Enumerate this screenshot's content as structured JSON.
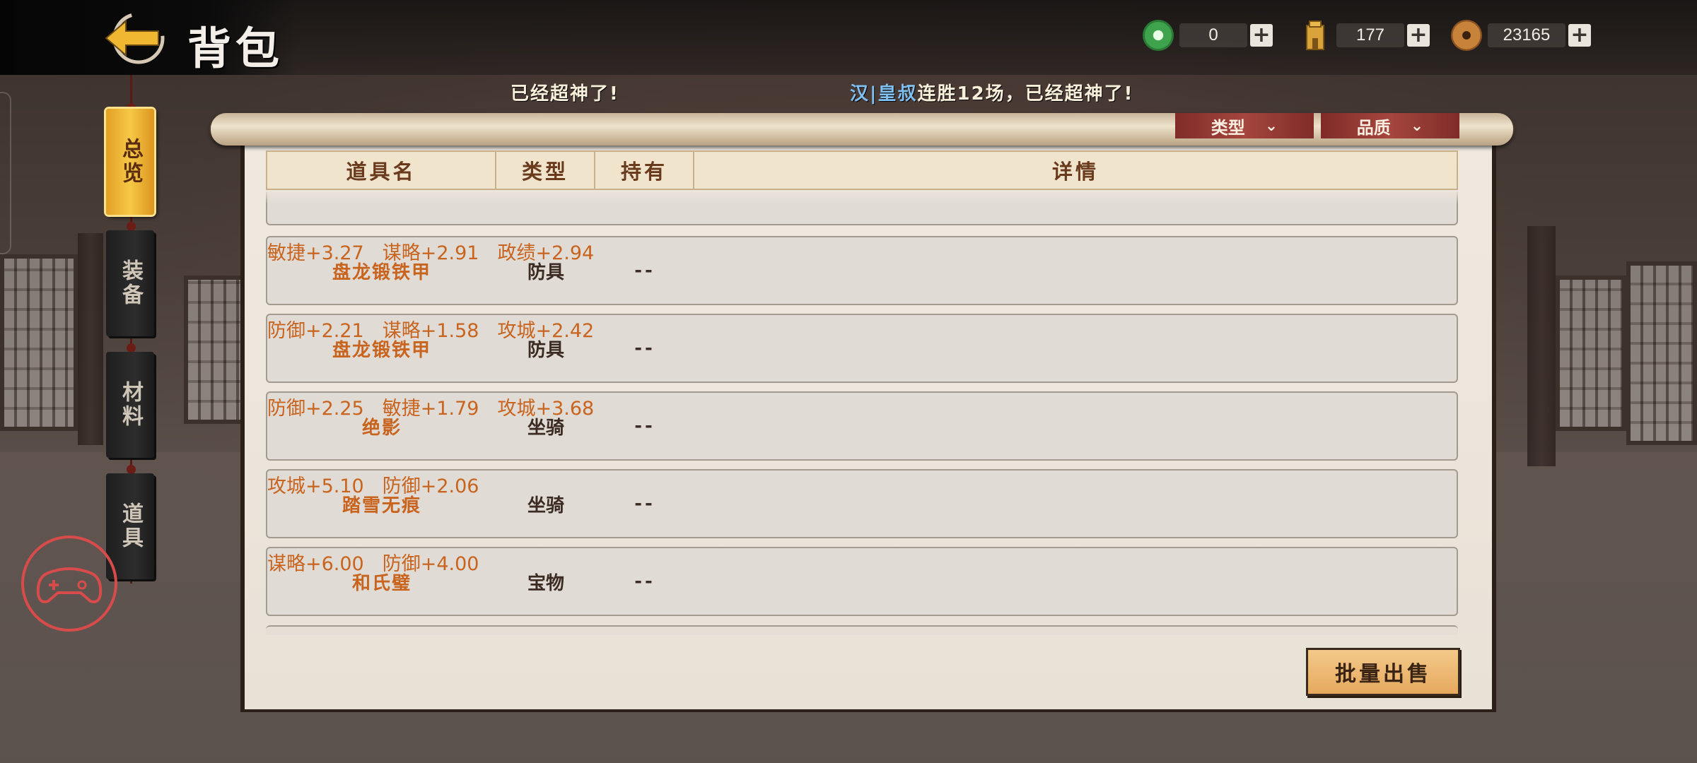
{
  "header": {
    "title": "背包",
    "back_icon": "back-arrow-icon"
  },
  "currencies": [
    {
      "icon": "jade-coin-icon",
      "value": "0",
      "color": "#3fa34d"
    },
    {
      "icon": "tower-token-icon",
      "value": "177",
      "color": "#d9a23a"
    },
    {
      "icon": "copper-coin-icon",
      "value": "23165",
      "color": "#b8742e"
    }
  ],
  "broadcast": {
    "left_text": "已经超神了!",
    "name": "汉|皇叔",
    "right_text": "连胜12场，已经超神了!"
  },
  "tabs": [
    {
      "label": "总览",
      "active": true
    },
    {
      "label": "装备",
      "active": false
    },
    {
      "label": "材料",
      "active": false
    },
    {
      "label": "道具",
      "active": false
    }
  ],
  "filters": {
    "type": "类型",
    "quality": "品质"
  },
  "table": {
    "columns": [
      "道具名",
      "类型",
      "持有",
      "详情"
    ],
    "rows": [
      {
        "name": "盘龙锻铁甲",
        "type": "防具",
        "owned": "--",
        "details": [
          "敏捷+3.27",
          "谋略+2.91",
          "政绩+2.94"
        ]
      },
      {
        "name": "盘龙锻铁甲",
        "type": "防具",
        "owned": "--",
        "details": [
          "防御+2.21",
          "谋略+1.58",
          "攻城+2.42"
        ]
      },
      {
        "name": "绝影",
        "type": "坐骑",
        "owned": "--",
        "details": [
          "防御+2.25",
          "敏捷+1.79",
          "攻城+3.68"
        ]
      },
      {
        "name": "踏雪无痕",
        "type": "坐骑",
        "owned": "--",
        "details": [
          "攻城+5.10",
          "防御+2.06"
        ]
      },
      {
        "name": "和氏璧",
        "type": "宝物",
        "owned": "--",
        "details": [
          "谋略+6.00",
          "防御+4.00"
        ]
      }
    ]
  },
  "actions": {
    "batch_sell": "批量出售"
  },
  "float_button": {
    "icon": "gamepad-icon",
    "color": "#d74b4b"
  }
}
